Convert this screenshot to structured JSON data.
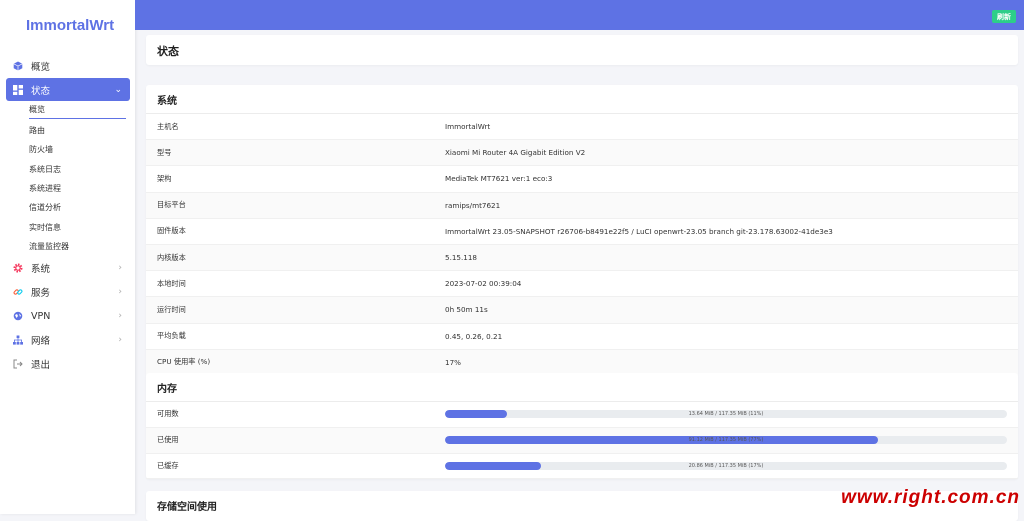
{
  "app": {
    "logo": "ImmortalWrt"
  },
  "sidebar": {
    "items": [
      {
        "label": "概览",
        "icon": "cube-icon"
      },
      {
        "label": "状态",
        "icon": "dashboard-icon",
        "active": true
      },
      {
        "label": "系统",
        "icon": "gear-icon"
      },
      {
        "label": "服务",
        "icon": "link-icon"
      },
      {
        "label": "VPN",
        "icon": "vpn-icon"
      },
      {
        "label": "网络",
        "icon": "network-icon"
      },
      {
        "label": "退出",
        "icon": "logout-icon"
      }
    ],
    "status_sub": [
      "概览",
      "路由",
      "防火墙",
      "系统日志",
      "系统进程",
      "信道分析",
      "实时信息",
      "流量监控器"
    ]
  },
  "topbar": {
    "refresh_label": "刷新"
  },
  "page": {
    "title": "状态"
  },
  "system": {
    "title": "系统",
    "rows": [
      {
        "key": "主机名",
        "value": "ImmortalWrt"
      },
      {
        "key": "型号",
        "value": "Xiaomi Mi Router 4A Gigabit Edition V2"
      },
      {
        "key": "架构",
        "value": "MediaTek MT7621 ver:1 eco:3"
      },
      {
        "key": "目标平台",
        "value": "ramips/mt7621"
      },
      {
        "key": "固件版本",
        "value": "ImmortalWrt 23.05-SNAPSHOT r26706-b8491e22f5 / LuCI openwrt-23.05 branch git-23.178.63002-41de3e3"
      },
      {
        "key": "内核版本",
        "value": "5.15.118"
      },
      {
        "key": "本地时间",
        "value": "2023-07-02 00:39:04"
      },
      {
        "key": "运行时间",
        "value": "0h 50m 11s"
      },
      {
        "key": "平均负载",
        "value": "0.45, 0.26, 0.21"
      },
      {
        "key": "CPU 使用率 (%)",
        "value": "17%"
      }
    ]
  },
  "memory": {
    "title": "内存",
    "rows": [
      {
        "key": "可用数",
        "label": "13.64 MiB / 117.35 MiB (11%)",
        "percent": 11
      },
      {
        "key": "已使用",
        "label": "91.12 MiB / 117.35 MiB (77%)",
        "percent": 77
      },
      {
        "key": "已缓存",
        "label": "20.86 MiB / 117.35 MiB (17%)",
        "percent": 17
      }
    ]
  },
  "storage": {
    "title": "存储空间使用"
  },
  "watermark": "www.right.com.cn",
  "colors": {
    "accent": "#5e72e4",
    "refresh": "#2dce89",
    "watermark": "#cc0000"
  }
}
